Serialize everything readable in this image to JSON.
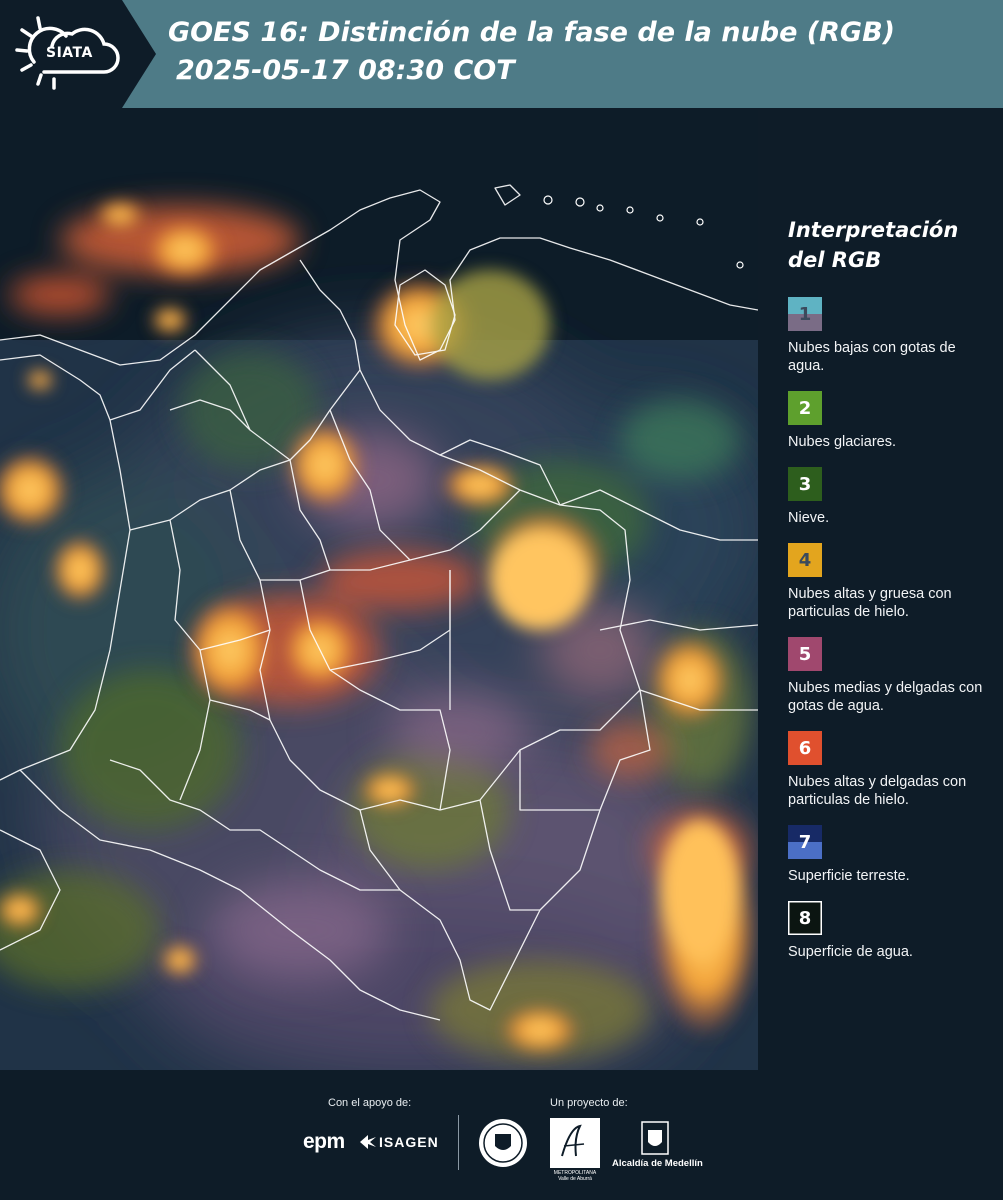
{
  "header": {
    "logo_text": "SIATA",
    "title_line1": "GOES 16: Distinción de la fase de la nube (RGB)",
    "title_line2": "2025-05-17 08:30 COT"
  },
  "legend": {
    "title": "Interpretación del RGB",
    "items": [
      {
        "number": "1",
        "label": "Nubes bajas con gotas de agua.",
        "color_top": "#5fb3c3",
        "color_bottom": "#7a6c86",
        "text_color": "#3b4a5c"
      },
      {
        "number": "2",
        "label": "Nubes glaciares.",
        "color_top": "#5ea02d",
        "color_bottom": "#5ea02d",
        "text_color": "#ffffff"
      },
      {
        "number": "3",
        "label": "Nieve.",
        "color_top": "#2d5e1d",
        "color_bottom": "#2d5e1d",
        "text_color": "#ffffff"
      },
      {
        "number": "4",
        "label": "Nubes altas y gruesa con particulas de hielo.",
        "color_top": "#e3a51e",
        "color_bottom": "#e3a51e",
        "text_color": "#3b4a5c"
      },
      {
        "number": "5",
        "label": "Nubes medias y delgadas con gotas de agua.",
        "color_top": "#a0486e",
        "color_bottom": "#a0486e",
        "text_color": "#ffffff"
      },
      {
        "number": "6",
        "label": "Nubes altas y delgadas con particulas de hielo.",
        "color_top": "#e0502e",
        "color_bottom": "#e0502e",
        "text_color": "#ffffff"
      },
      {
        "number": "7",
        "label": "Superficie terreste.",
        "color_top": "#172a66",
        "color_bottom": "#4b6fc6",
        "text_color": "#ffffff"
      },
      {
        "number": "8",
        "label": "Superficie de agua.",
        "color_top": "#0b1511",
        "color_bottom": "#0b1511",
        "text_color": "#ffffff",
        "border": "#ffffff"
      }
    ]
  },
  "footer": {
    "support_label": "Con el apoyo de:",
    "project_label": "Un proyecto de:",
    "epm": "epm",
    "isagen": "ISAGEN",
    "area_line1": "METROPOLITANA",
    "area_line2": "Valle de Aburrá",
    "alcaldia": "Alcaldía de Medellín"
  }
}
